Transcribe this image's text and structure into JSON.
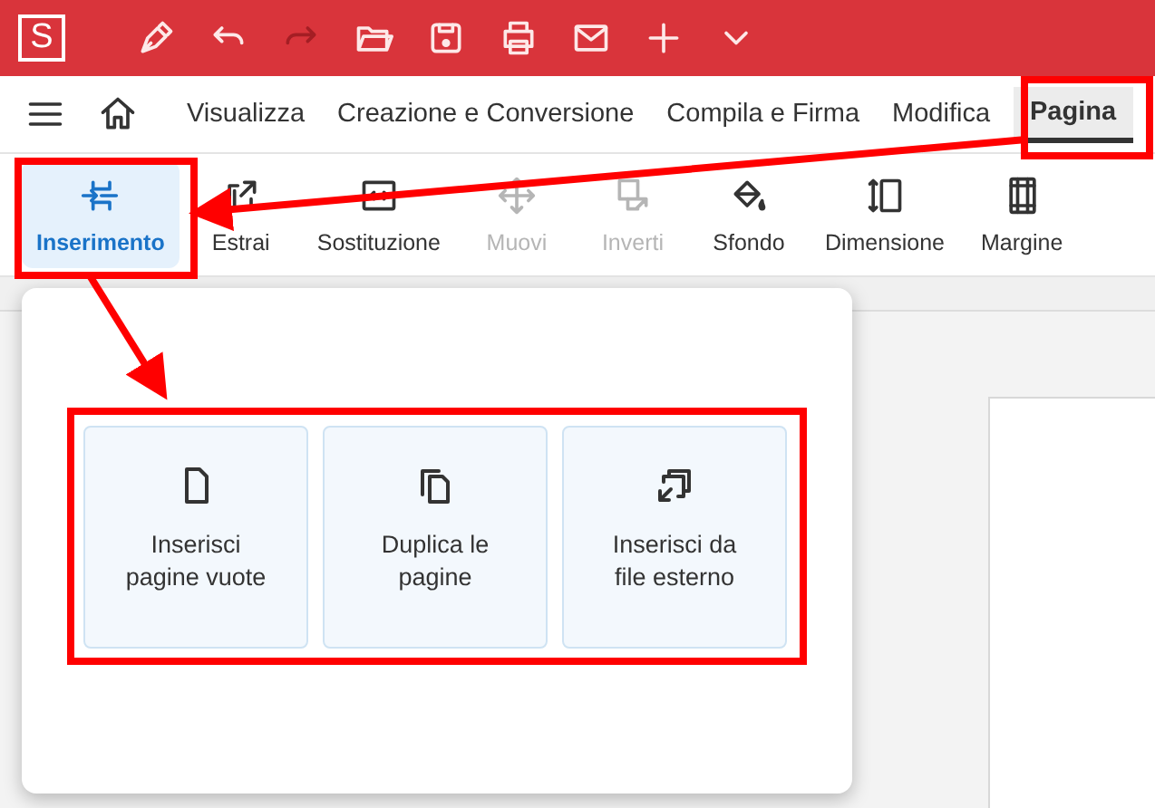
{
  "app_logo": "S",
  "menu_tabs": [
    {
      "label": "Visualizza",
      "selected": false
    },
    {
      "label": "Creazione e Conversione",
      "selected": false
    },
    {
      "label": "Compila e Firma",
      "selected": false
    },
    {
      "label": "Modifica",
      "selected": false
    },
    {
      "label": "Pagina",
      "selected": true
    }
  ],
  "ribbon": [
    {
      "label": "Inserimento",
      "selected": true,
      "disabled": false
    },
    {
      "label": "Estrai",
      "selected": false,
      "disabled": false
    },
    {
      "label": "Sostituzione",
      "selected": false,
      "disabled": false
    },
    {
      "label": "Muovi",
      "selected": false,
      "disabled": true
    },
    {
      "label": "Inverti",
      "selected": false,
      "disabled": true
    },
    {
      "label": "Sfondo",
      "selected": false,
      "disabled": false
    },
    {
      "label": "Dimensione",
      "selected": false,
      "disabled": false
    },
    {
      "label": "Margine",
      "selected": false,
      "disabled": false
    }
  ],
  "insert_menu": [
    {
      "label": "Inserisci pagine vuote"
    },
    {
      "label": "Duplica le pagine"
    },
    {
      "label": "Inserisci da file esterno"
    }
  ]
}
